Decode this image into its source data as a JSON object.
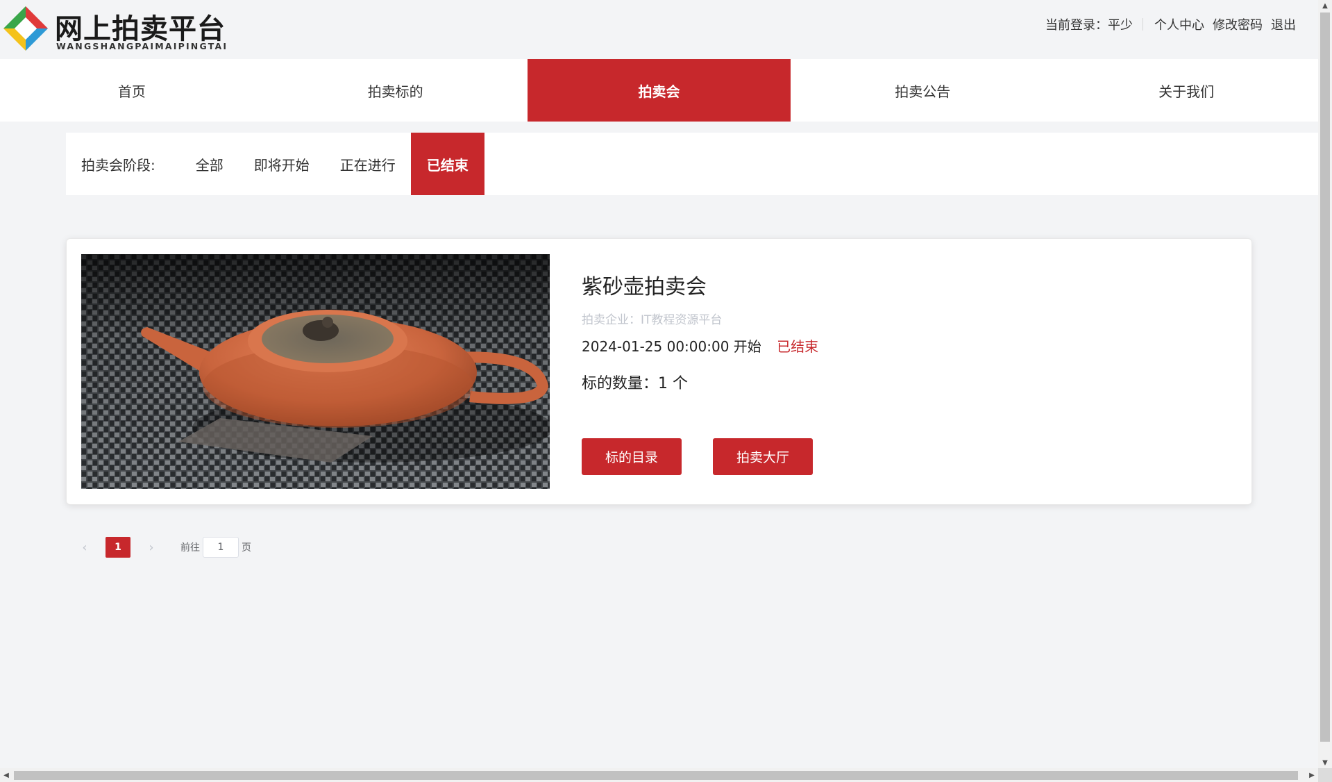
{
  "header": {
    "logo_title": "网上拍卖平台",
    "logo_subtitle": "WANGSHANGPAIMAIPINGTAI",
    "login_label": "当前登录：",
    "user_name": "平少",
    "links": [
      "个人中心",
      "修改密码",
      "退出"
    ]
  },
  "nav": {
    "items": [
      "首页",
      "拍卖标的",
      "拍卖会",
      "拍卖公告",
      "关于我们"
    ],
    "active": "拍卖会"
  },
  "stage_filter": {
    "label": "拍卖会阶段:",
    "items": [
      "全部",
      "即将开始",
      "正在进行",
      "已结束"
    ],
    "active": "已结束"
  },
  "auctions": [
    {
      "title": "紫砂壶拍卖会",
      "company_label": "拍卖企业：",
      "company": "IT教程资源平台",
      "start_time": "2024-01-25 00:00:00 开始",
      "status": "已结束",
      "count_label": "标的数量：",
      "count": "1 个",
      "buttons": [
        "标的目录",
        "拍卖大厅"
      ],
      "image": "teapot-photo"
    }
  ],
  "pagination": {
    "current_page": "1",
    "goto_label": "前往",
    "page_input": "1",
    "page_suffix": "页"
  },
  "colors": {
    "accent": "#c7282c",
    "background": "#f3f4f6"
  }
}
